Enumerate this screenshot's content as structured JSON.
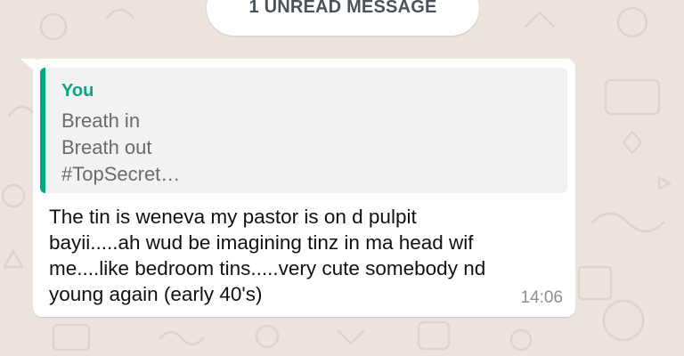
{
  "banner": {
    "unread_label": "1 UNREAD MESSAGE"
  },
  "message": {
    "quoted": {
      "author": "You",
      "lines": [
        "Breath in",
        "Breath out",
        "#TopSecret…"
      ]
    },
    "text_lines": [
      "The tin is weneva my pastor is on d pulpit",
      "bayii.....ah wud be imagining tinz in ma head wif",
      "me....like bedroom tins.....very cute somebody nd",
      "young again (early 40's)"
    ],
    "time": "14:06"
  },
  "colors": {
    "background": "#ece5dd",
    "bubble": "#ffffff",
    "quote_accent": "#06a884",
    "quote_background": "#f2f2f2"
  },
  "icons": [
    "doodle-wallpaper-icon"
  ]
}
